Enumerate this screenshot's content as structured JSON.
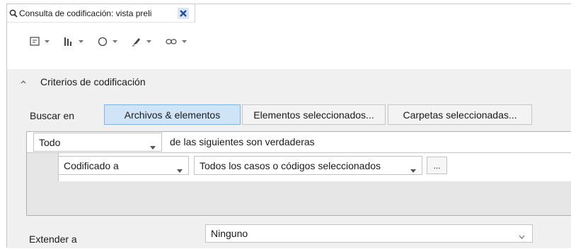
{
  "tab": {
    "title": "Consulta de codificación: vista preli",
    "icon": "magnifier-icon",
    "close_icon": "close-icon"
  },
  "toolbar": {
    "items": [
      "note-icon",
      "chart-icon",
      "shape-icon",
      "highlight-icon",
      "link-icon"
    ]
  },
  "section": {
    "title": "Criterios de codificación"
  },
  "search_in": {
    "label": "Buscar en",
    "buttons": [
      "Archivos & elementos",
      "Elementos seleccionados...",
      "Carpetas seleccionadas..."
    ],
    "active": "Archivos & elementos"
  },
  "condition": {
    "quantifier": "Todo",
    "suffix": "de las siguientes son verdaderas"
  },
  "criterion": {
    "field": "Codificado a",
    "value": "Todos los casos o códigos seleccionados",
    "more_label": "..."
  },
  "extend": {
    "label": "Extender a",
    "value": "Ninguno"
  },
  "colors": {
    "active_button": "#cfe5f7",
    "close_icon": "#1f4e9c"
  }
}
